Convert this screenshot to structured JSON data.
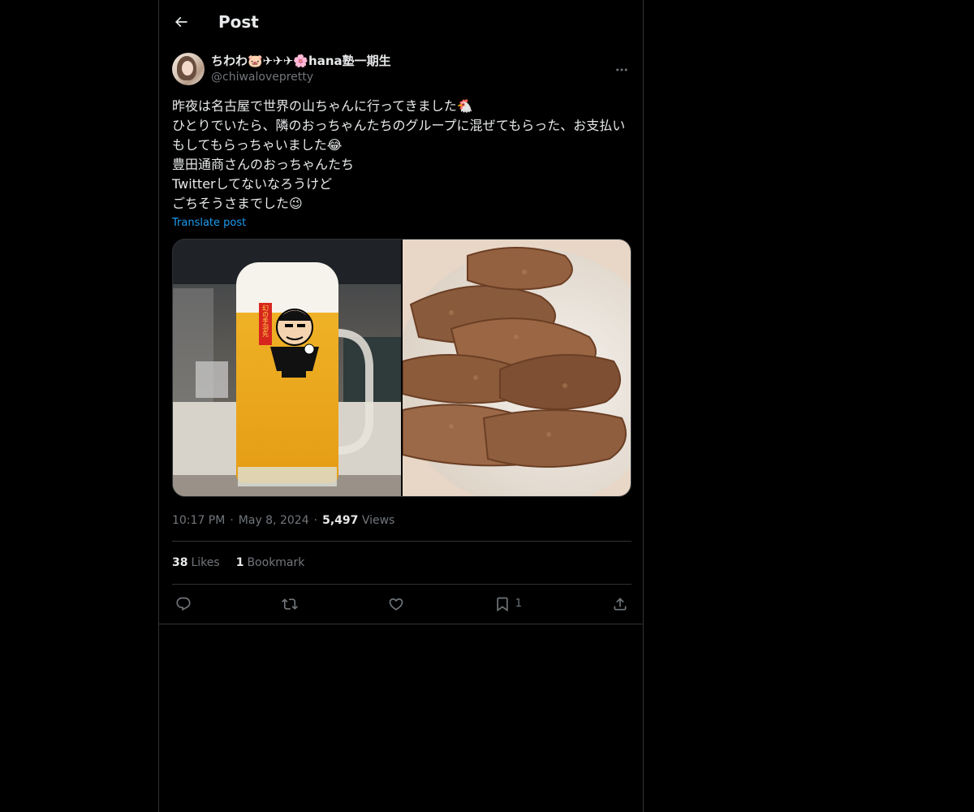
{
  "header": {
    "title": "Post"
  },
  "author": {
    "display_name": "ちわわ🐷✈✈✈🌸hana塾一期生",
    "handle": "@chiwalovepretty"
  },
  "post": {
    "text": "昨夜は名古屋で世界の山ちゃんに行ってきました🐔\nひとりでいたら、隣のおっちゃんたちのグループに混ぜてもらった、お支払いもしてもらっちゃいました😂\n豊田通商さんのおっちゃんたち\nTwitterしてないなろうけど\nごちそうさまでした😉",
    "translate_label": "Translate post",
    "time": "10:17 PM",
    "date": "May 8, 2024",
    "views_count": "5,497",
    "views_label": "Views",
    "mug_flag_text": "幻の手羽先"
  },
  "stats": {
    "likes_count": "38",
    "likes_label": "Likes",
    "bookmarks_count": "1",
    "bookmarks_label": "Bookmark"
  },
  "actions": {
    "bookmark_count": "1"
  },
  "icons": {
    "back": "back-arrow-icon",
    "more": "more-icon",
    "reply": "reply-icon",
    "repost": "repost-icon",
    "like": "heart-icon",
    "bookmark": "bookmark-icon",
    "share": "share-icon"
  },
  "colors": {
    "background": "#000000",
    "text_primary": "#e7e9ea",
    "text_secondary": "#71767b",
    "link": "#1d9bf0",
    "border": "#2f3336"
  }
}
